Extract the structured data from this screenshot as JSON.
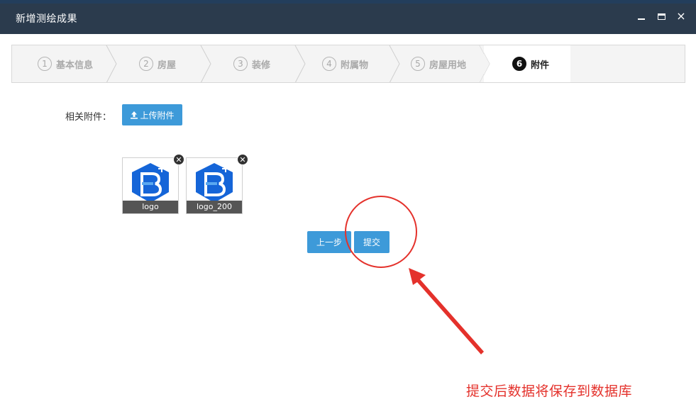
{
  "window": {
    "title": "新增测绘成果",
    "minimize_glyph": "",
    "close_glyph": "×"
  },
  "steps": [
    {
      "num": "1",
      "label": "基本信息",
      "active": false
    },
    {
      "num": "2",
      "label": "房屋",
      "active": false
    },
    {
      "num": "3",
      "label": "装修",
      "active": false
    },
    {
      "num": "4",
      "label": "附属物",
      "active": false
    },
    {
      "num": "5",
      "label": "房屋用地",
      "active": false
    },
    {
      "num": "6",
      "label": "附件",
      "active": true
    }
  ],
  "attachments": {
    "label": "相关附件：",
    "upload_label": "上传附件",
    "files": [
      {
        "name": "logo"
      },
      {
        "name": "logo_200"
      }
    ]
  },
  "actions": {
    "prev_label": "上一步",
    "submit_label": "提交"
  },
  "annotation": {
    "text": "提交后数据将保存到数据库",
    "color": "#e4312b"
  },
  "colors": {
    "titlebar": "#2b3b4d",
    "primary": "#3d9ad9",
    "logo_blue": "#1565d8"
  }
}
